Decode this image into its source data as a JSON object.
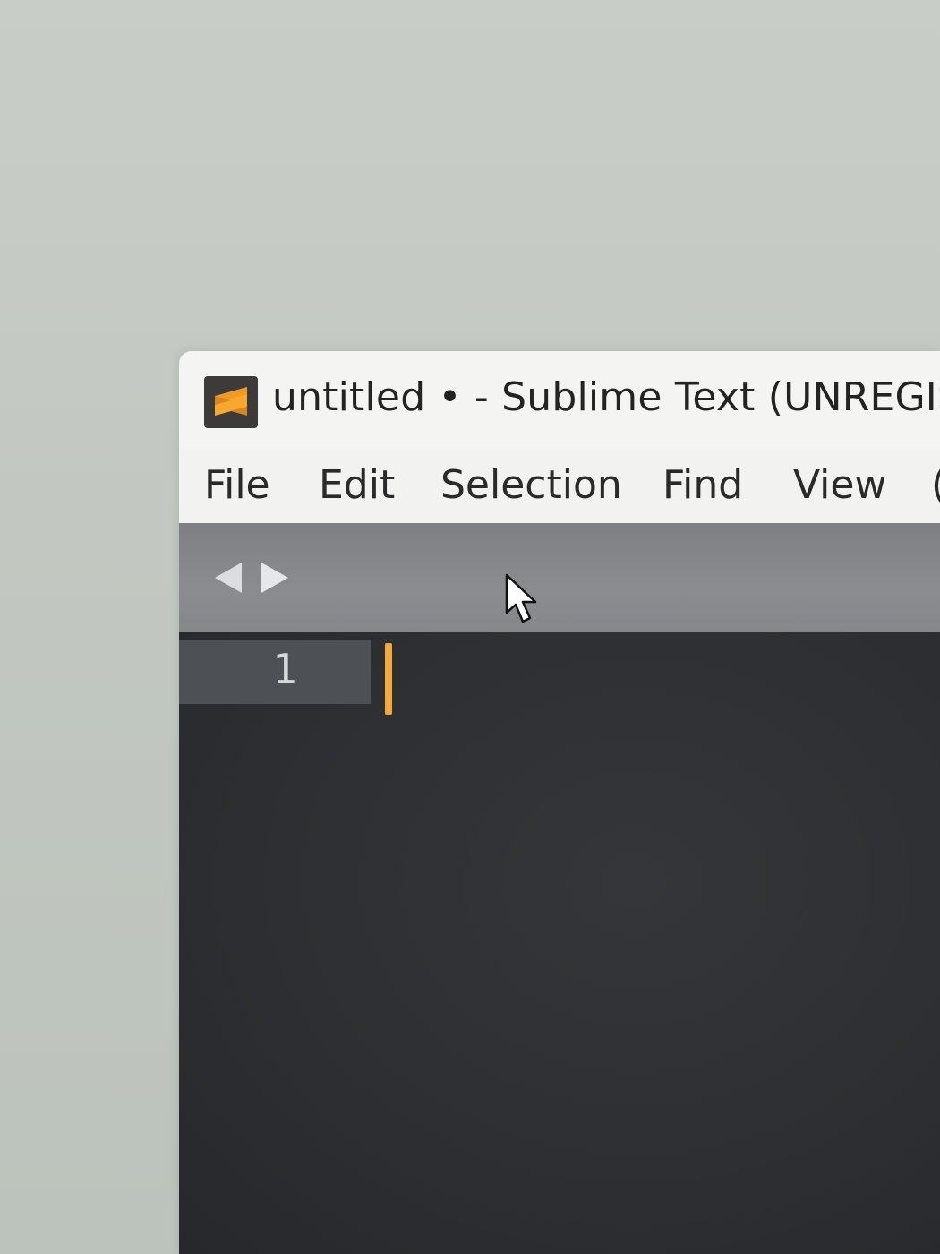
{
  "window": {
    "title": "untitled • - Sublime Text (UNREGISTE",
    "app_icon": "sublime-text-logo-icon"
  },
  "menu": {
    "items": [
      {
        "label": "File"
      },
      {
        "label": "Edit"
      },
      {
        "label": "Selection"
      },
      {
        "label": "Find"
      },
      {
        "label": "View"
      },
      {
        "label": "("
      }
    ]
  },
  "tabbar": {
    "back_icon": "triangle-left-icon",
    "forward_icon": "triangle-right-icon"
  },
  "editor": {
    "lines": [
      {
        "number": "1",
        "text": ""
      }
    ],
    "caret_color": "#f2a93a"
  },
  "colors": {
    "accent": "#f2a93a",
    "editor_bg": "#2d2f32",
    "gutter_active": "#4d5155"
  }
}
